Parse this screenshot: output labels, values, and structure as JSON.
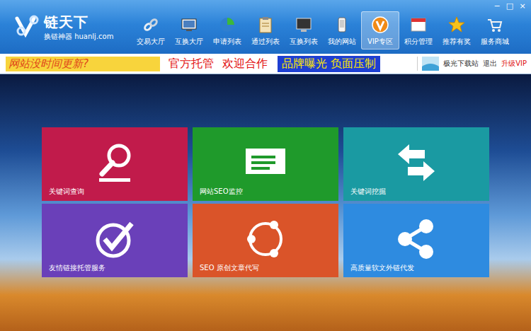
{
  "window": {
    "controls": [
      "−",
      "□",
      "×"
    ]
  },
  "logo": {
    "title": "链天下",
    "subtitle": "换链神器 huanlj.com"
  },
  "nav": [
    {
      "label": "交易大厅",
      "selected": false
    },
    {
      "label": "互换大厅",
      "selected": false
    },
    {
      "label": "申请列表",
      "selected": false
    },
    {
      "label": "通过列表",
      "selected": false
    },
    {
      "label": "互换列表",
      "selected": false
    },
    {
      "label": "我的网站",
      "selected": false
    },
    {
      "label": "VIP专区",
      "selected": true
    },
    {
      "label": "积分管理",
      "selected": false
    },
    {
      "label": "推荐有奖",
      "selected": false
    },
    {
      "label": "服务商城",
      "selected": false
    }
  ],
  "banner": {
    "ad_yellow": "网站没时间更新?",
    "ad_red": [
      "官方托管",
      "欢迎合作"
    ],
    "ad_blue": "品牌曝光 负面压制"
  },
  "user": {
    "name": "极光下载站",
    "logout": "退出",
    "upgrade": "升级VIP"
  },
  "tiles": [
    {
      "label": "关键词查询",
      "color": "#c11b4b"
    },
    {
      "label": "网站SEO监控",
      "color": "#1f9a2b"
    },
    {
      "label": "关键词挖掘",
      "color": "#1a9aa2"
    },
    {
      "label": "友情链接托管服务",
      "color": "#6a40b9"
    },
    {
      "label": "SEO 原创文章代写",
      "color": "#da5429"
    },
    {
      "label": "高质量软文外链代发",
      "color": "#2e8be0"
    }
  ]
}
